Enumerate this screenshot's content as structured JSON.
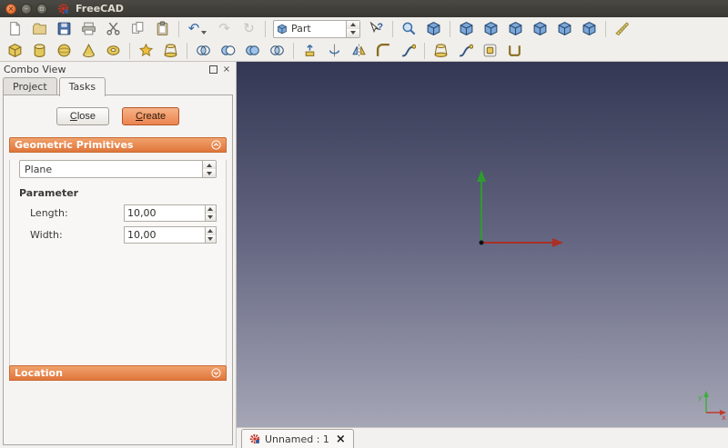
{
  "window": {
    "title": "FreeCAD"
  },
  "toolbars": {
    "workbench": {
      "value": "Part"
    },
    "row1_icons": [
      "new-file",
      "open",
      "save",
      "print",
      "cut",
      "copy",
      "paste",
      "undo",
      "redo",
      "refresh",
      "workbench-selector",
      "whats-this",
      "fit-all",
      "axonometric-view",
      "front-view",
      "top-view",
      "right-view",
      "rear-view",
      "bottom-view",
      "left-view",
      "measure-distance"
    ],
    "row2_icons": [
      "box",
      "cylinder",
      "sphere",
      "cone",
      "torus",
      "primitives",
      "shape-builder",
      "boolean",
      "boolean-cut",
      "boolean-union",
      "boolean-common",
      "extrude",
      "revolve",
      "mirror",
      "fillet",
      "ruled-surface",
      "loft",
      "sweep",
      "offset",
      "thickness"
    ]
  },
  "combo_view": {
    "title": "Combo View",
    "tabs": [
      {
        "label": "Project"
      },
      {
        "label": "Tasks"
      }
    ],
    "buttons": {
      "close": "Close",
      "create": "Create"
    },
    "geometric_primitives": {
      "title": "Geometric Primitives",
      "primitive": "Plane",
      "parameter_heading": "Parameter",
      "fields": [
        {
          "label": "Length:",
          "value": "10,00"
        },
        {
          "label": "Width:",
          "value": "10,00"
        }
      ]
    },
    "location": {
      "title": "Location"
    }
  },
  "viewport": {
    "axis_labels": {
      "x": "x",
      "y": "y"
    },
    "colors": {
      "gradient_top": "#343753",
      "gradient_bottom": "#a5a6b6",
      "axis_green": "#2e9b2e",
      "axis_red": "#aa2f25",
      "accent_orange": "#e0763b"
    }
  },
  "document_tab": {
    "label": "Unnamed : 1"
  }
}
